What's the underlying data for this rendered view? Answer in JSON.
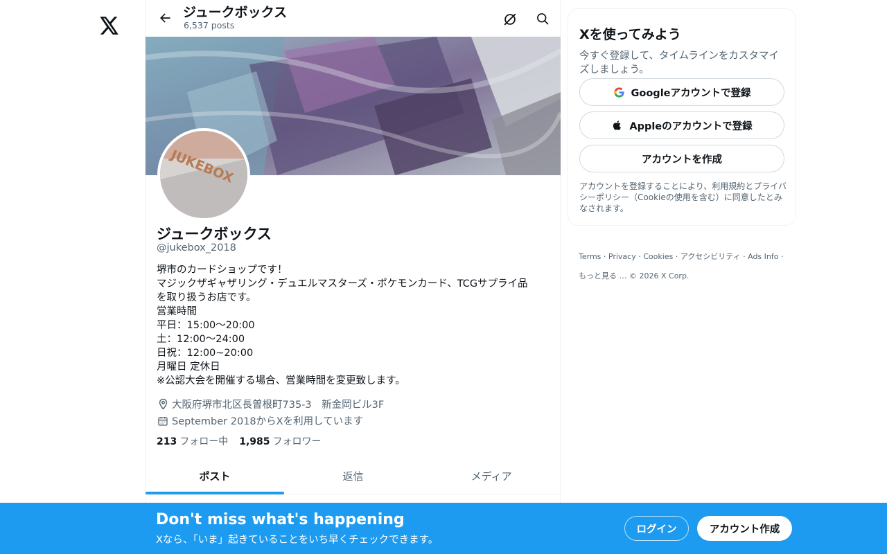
{
  "nav": {
    "logo_icon": "x-logo-icon"
  },
  "header": {
    "title": "ジュークボックス",
    "posts_count": "6,537 posts",
    "back_icon": "arrow-left-icon",
    "grok_icon": "grok-icon",
    "search_icon": "search-icon"
  },
  "profile": {
    "avatar_text": "JUKEBOX",
    "name": "ジュークボックス",
    "handle": "@jukebox_2018",
    "bio_lines": [
      "堺市のカードショップです！",
      "マジックザギャザリング・デュエルマスターズ・ポケモンカード、TCGサプライ品",
      "を取り扱うお店です。",
      "営業時間",
      "平日：15:00〜20:00",
      "土：12:00〜24:00",
      "日祝：12:00~20:00",
      "月曜日 定休日",
      "※公認大会を開催する場合、営業時間を変更致します。"
    ],
    "location": "大阪府堺市北区長曽根町735-3　新金岡ビル3F",
    "joined": "September 2018からXを利用しています",
    "following_count": "213",
    "following_label": "フォロー中",
    "followers_count": "1,985",
    "followers_label": "フォロワー"
  },
  "tabs": [
    {
      "label": "ポスト",
      "active": true
    },
    {
      "label": "返信",
      "active": false
    },
    {
      "label": "メディア",
      "active": false
    }
  ],
  "signup_card": {
    "title": "Xを使ってみよう",
    "subtitle": "今すぐ登録して、タイムラインをカスタマイズしましょう。",
    "google_label": "Googleアカウントで登録",
    "apple_label": "Appleのアカウントで登録",
    "create_label": "アカウントを作成",
    "terms": "アカウントを登録することにより、利用規約とプライバシーポリシー（Cookieの使用を含む）に同意したとみなされます。"
  },
  "footer": {
    "terms": "Terms",
    "privacy": "Privacy",
    "cookies": "Cookies",
    "accessibility": "アクセシビリティ",
    "ads": "Ads Info",
    "more": "もっと見る …",
    "copyright": "© 2026 X Corp."
  },
  "bottom_bar": {
    "title": "Don't miss what's happening",
    "subtitle": "Xなら、「いま」起きていることをいち早くチェックできます。",
    "login_label": "ログイン",
    "signup_label": "アカウント作成"
  },
  "colors": {
    "accent": "#1d9bf0",
    "text": "#0f1419",
    "secondary": "#536471",
    "border": "#eff3f4"
  }
}
